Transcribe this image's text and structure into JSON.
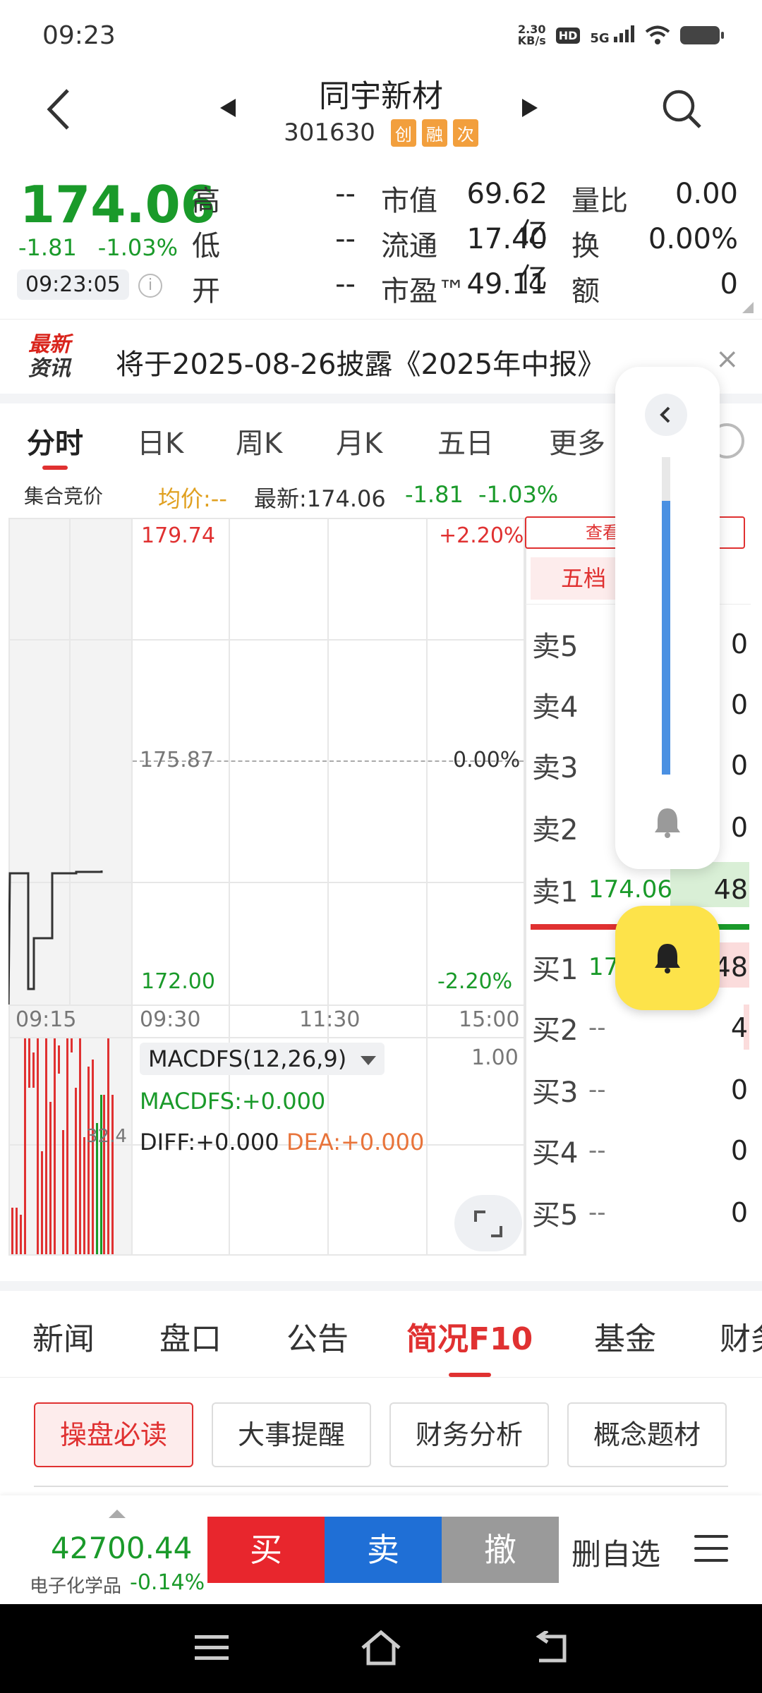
{
  "status": {
    "time": "09:23",
    "net_speed_value": "2.30",
    "net_speed_unit": "KB/s",
    "hd": "HD",
    "network": "5G"
  },
  "header": {
    "stock_name": "同宇新材",
    "stock_code": "301630",
    "tags": [
      "创",
      "融",
      "次"
    ]
  },
  "quote": {
    "price": "174.06",
    "change": "-1.81",
    "change_pct": "-1.03%",
    "time": "09:23:05",
    "stats": [
      {
        "label": "高",
        "value": "--"
      },
      {
        "label": "低",
        "value": "--"
      },
      {
        "label": "开",
        "value": "--"
      }
    ],
    "market": [
      {
        "label": "市值",
        "value": "69.62亿"
      },
      {
        "label": "流通",
        "value": "17.40亿"
      },
      {
        "label": "市盈™",
        "value": "49.11"
      }
    ],
    "ratios": [
      {
        "label": "量比",
        "value": "0.00"
      },
      {
        "label": "换",
        "value": "0.00%"
      },
      {
        "label": "额",
        "value": "0"
      }
    ],
    "ratio_colors": {
      "量比": "#1a9a2a"
    }
  },
  "news": {
    "logo_top": "最新",
    "logo_bottom": "资讯",
    "text": "将于2025-08-26披露《2025年中报》",
    "close": "×"
  },
  "chart_tabs": [
    "分时",
    "日K",
    "周K",
    "月K",
    "五日",
    "更多"
  ],
  "chart_meta": {
    "auction": "集合竞价",
    "avg": "均价:--",
    "latest": "最新:174.06",
    "chg": "-1.81",
    "chg_pct": "-1.03%"
  },
  "chart_labels": {
    "high": "179.74",
    "high_pct": "+2.20%",
    "mid": "175.87",
    "mid_pct": "0.00%",
    "low": "172.00",
    "low_pct": "-2.20%",
    "times": [
      "09:15",
      "09:30",
      "11:30",
      "15:00"
    ],
    "macd_title": "MACDFS(12,26,9)",
    "macd_value": "MACDFS:+0.000",
    "diff": "DIFF:+0.000",
    "dea": "DEA:+0.000",
    "macd_max": "1.00",
    "vol_label": "32.4"
  },
  "order_book": {
    "view_btn": "查看",
    "tab": "五档",
    "asks": [
      {
        "label": "卖5",
        "price": "",
        "vol": "0"
      },
      {
        "label": "卖4",
        "price": "",
        "vol": "0"
      },
      {
        "label": "卖3",
        "price": "",
        "vol": "0"
      },
      {
        "label": "卖2",
        "price": "",
        "vol": "0"
      },
      {
        "label": "卖1",
        "price": "174.06",
        "vol": "48"
      }
    ],
    "bids": [
      {
        "label": "买1",
        "price": "17",
        "vol": "48"
      },
      {
        "label": "买2",
        "price": "--",
        "vol": "4"
      },
      {
        "label": "买3",
        "price": "--",
        "vol": "0"
      },
      {
        "label": "买4",
        "price": "--",
        "vol": "0"
      },
      {
        "label": "买5",
        "price": "--",
        "vol": "0"
      }
    ]
  },
  "lower_tabs": [
    "新闻",
    "盘口",
    "公告",
    "简况F10",
    "基金",
    "财务"
  ],
  "chips": [
    "操盘必读",
    "大事提醒",
    "财务分析",
    "概念题材"
  ],
  "bottom": {
    "index_value": "42700.44",
    "index_name": "电子化学品",
    "index_chg": "-0.14%",
    "buy": "买",
    "sell": "卖",
    "cancel": "撤",
    "remove_fav": "删自选"
  },
  "colors": {
    "up": "#e03131",
    "down": "#1a9a2a",
    "buy": "#e8262d",
    "sell": "#1f6fd6",
    "cancel": "#9a9a9a",
    "accent": "#e03131"
  }
}
